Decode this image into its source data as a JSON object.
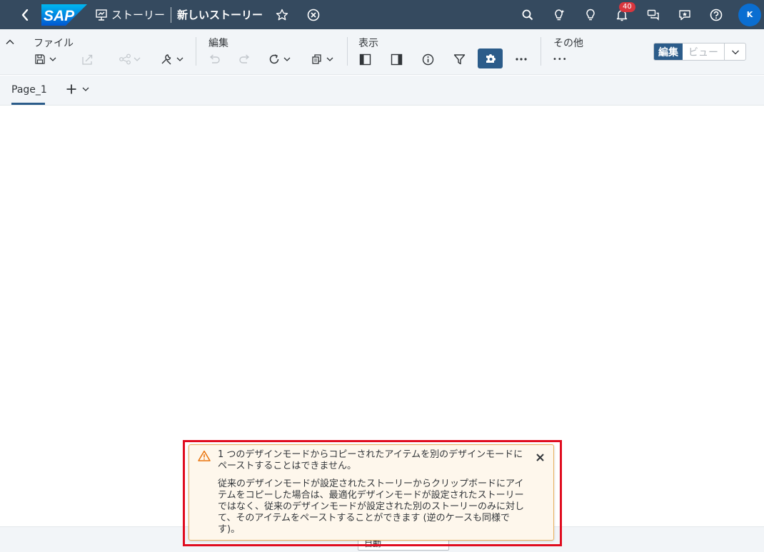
{
  "shell": {
    "brand": "SAP",
    "story_label": "ストーリー",
    "title": "新しいストーリー",
    "notification_count": "40",
    "avatar_initial": "K"
  },
  "toolbar": {
    "groups": {
      "file": "ファイル",
      "edit": "編集",
      "view": "表示",
      "more": "その他"
    },
    "more_dots": "•••",
    "mode": {
      "edit": "編集",
      "view": "ビュー"
    }
  },
  "pages": {
    "tabs": [
      {
        "label": "Page_1"
      }
    ]
  },
  "bottom": {
    "select_value": "自動"
  },
  "message": {
    "type": "warning",
    "line1": "1 つのデザインモードからコピーされたアイテムを別のデザインモードにペーストすることはできません。",
    "line2": "従来のデザインモードが設定されたストーリーからクリップボードにアイテムをコピーした場合は、最適化デザインモードが設定されたストーリーではなく、従来のデザインモードが設定された別のストーリーのみに対して、そのアイテムをペーストすることができます (逆のケースも同様です)。"
  },
  "colors": {
    "shell_bg": "#354a5f",
    "toolbar_bg": "#f2f5f8",
    "accent": "#2c5c8a",
    "warning_bg": "#fef7ec",
    "warning_border": "#e9b15e",
    "highlight_frame": "#e00c1f",
    "badge": "#d9363e",
    "avatar": "#0a6ed1"
  },
  "icons": [
    "back-icon",
    "sap-logo",
    "story-icon",
    "star-icon",
    "close-circle-icon",
    "search-icon",
    "assistant-icon",
    "lightbulb-icon",
    "bell-icon",
    "chat-icon",
    "feedback-icon",
    "help-icon",
    "save-icon",
    "export-icon",
    "share-icon",
    "tools-icon",
    "undo-icon",
    "redo-icon",
    "refresh-icon",
    "copy-icon",
    "left-panel-icon",
    "right-panel-icon",
    "info-icon",
    "filter-icon",
    "puzzle-icon",
    "more-icon",
    "plus-icon",
    "chevron-down-icon",
    "warning-icon",
    "close-icon"
  ]
}
